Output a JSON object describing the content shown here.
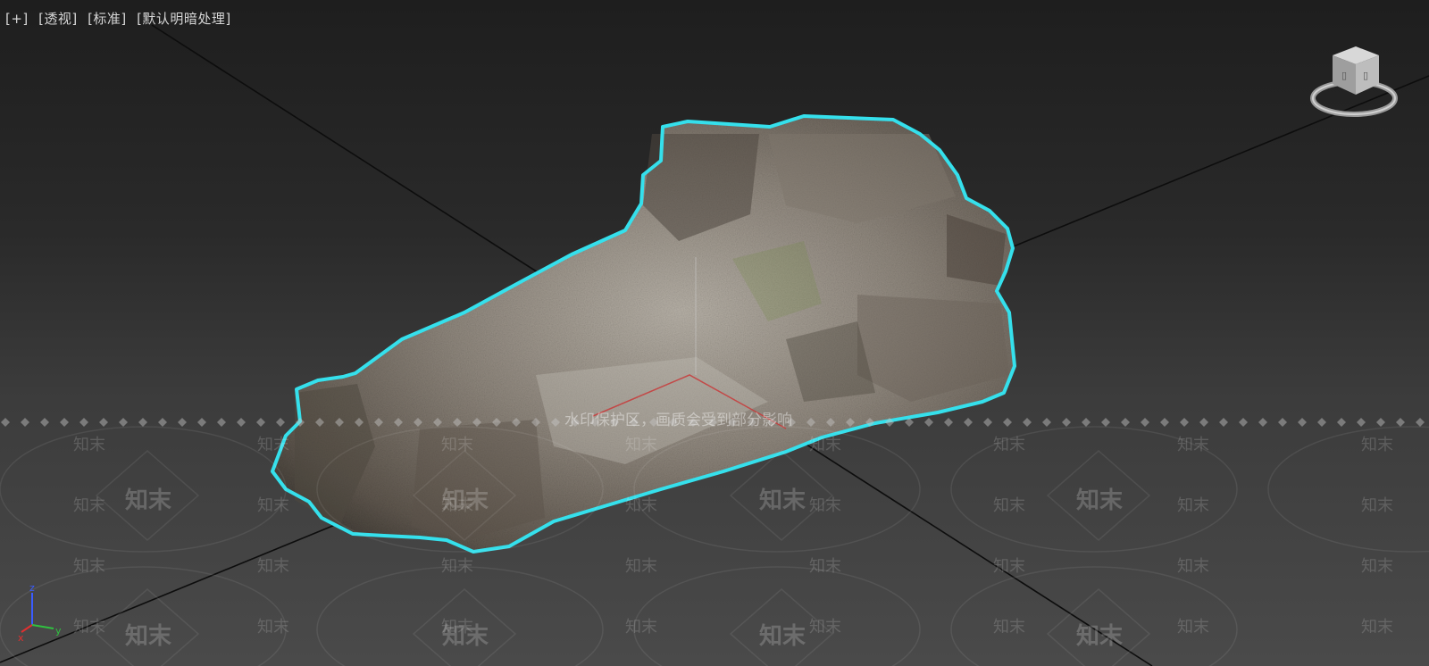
{
  "viewport": {
    "labels": [
      "[+]",
      "[透视]",
      "[标准]",
      "[默认明暗处理]"
    ],
    "selection_color": "#35e0ec"
  },
  "watermark": {
    "brand": "知末",
    "notice": "水印保护区，画质会受到部分影响"
  },
  "axis_tripod": {
    "x": "x",
    "y": "y",
    "z": "z"
  },
  "icons": {
    "view_cube": "view-cube-icon",
    "axis": "axis-tripod-icon"
  }
}
